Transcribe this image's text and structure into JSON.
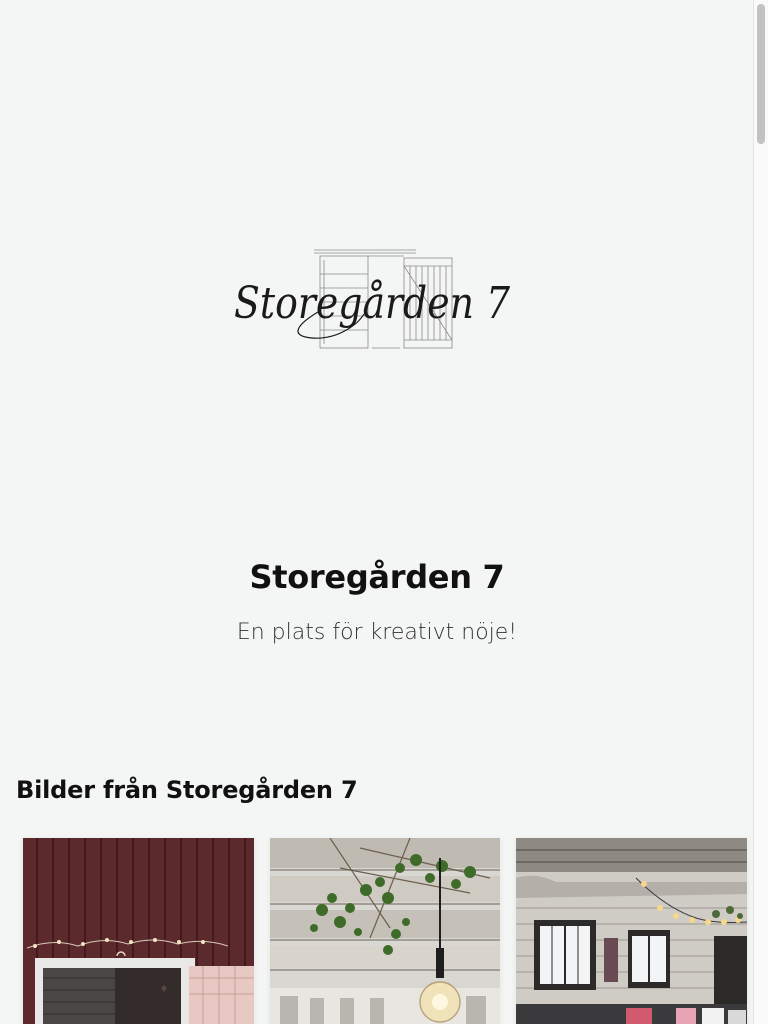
{
  "logo": {
    "script_text": "Storegården 7"
  },
  "hero": {
    "title": "Storegården 7",
    "subtitle": "En plats för kreativt nöje!"
  },
  "gallery": {
    "heading": "Bilder från Storegården 7",
    "photos": [
      {
        "icon": "barn-door-photo"
      },
      {
        "icon": "ceiling-lamp-photo"
      },
      {
        "icon": "lounge-interior-photo"
      }
    ]
  }
}
